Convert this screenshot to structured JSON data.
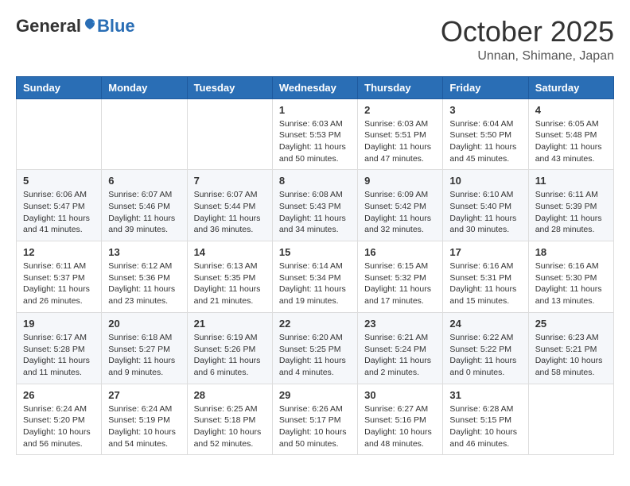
{
  "header": {
    "logo": {
      "general": "General",
      "blue": "Blue"
    },
    "title": "October 2025",
    "location": "Unnan, Shimane, Japan"
  },
  "weekdays": [
    "Sunday",
    "Monday",
    "Tuesday",
    "Wednesday",
    "Thursday",
    "Friday",
    "Saturday"
  ],
  "weeks": [
    [
      {
        "day": "",
        "content": ""
      },
      {
        "day": "",
        "content": ""
      },
      {
        "day": "",
        "content": ""
      },
      {
        "day": "1",
        "content": "Sunrise: 6:03 AM\nSunset: 5:53 PM\nDaylight: 11 hours\nand 50 minutes."
      },
      {
        "day": "2",
        "content": "Sunrise: 6:03 AM\nSunset: 5:51 PM\nDaylight: 11 hours\nand 47 minutes."
      },
      {
        "day": "3",
        "content": "Sunrise: 6:04 AM\nSunset: 5:50 PM\nDaylight: 11 hours\nand 45 minutes."
      },
      {
        "day": "4",
        "content": "Sunrise: 6:05 AM\nSunset: 5:48 PM\nDaylight: 11 hours\nand 43 minutes."
      }
    ],
    [
      {
        "day": "5",
        "content": "Sunrise: 6:06 AM\nSunset: 5:47 PM\nDaylight: 11 hours\nand 41 minutes."
      },
      {
        "day": "6",
        "content": "Sunrise: 6:07 AM\nSunset: 5:46 PM\nDaylight: 11 hours\nand 39 minutes."
      },
      {
        "day": "7",
        "content": "Sunrise: 6:07 AM\nSunset: 5:44 PM\nDaylight: 11 hours\nand 36 minutes."
      },
      {
        "day": "8",
        "content": "Sunrise: 6:08 AM\nSunset: 5:43 PM\nDaylight: 11 hours\nand 34 minutes."
      },
      {
        "day": "9",
        "content": "Sunrise: 6:09 AM\nSunset: 5:42 PM\nDaylight: 11 hours\nand 32 minutes."
      },
      {
        "day": "10",
        "content": "Sunrise: 6:10 AM\nSunset: 5:40 PM\nDaylight: 11 hours\nand 30 minutes."
      },
      {
        "day": "11",
        "content": "Sunrise: 6:11 AM\nSunset: 5:39 PM\nDaylight: 11 hours\nand 28 minutes."
      }
    ],
    [
      {
        "day": "12",
        "content": "Sunrise: 6:11 AM\nSunset: 5:37 PM\nDaylight: 11 hours\nand 26 minutes."
      },
      {
        "day": "13",
        "content": "Sunrise: 6:12 AM\nSunset: 5:36 PM\nDaylight: 11 hours\nand 23 minutes."
      },
      {
        "day": "14",
        "content": "Sunrise: 6:13 AM\nSunset: 5:35 PM\nDaylight: 11 hours\nand 21 minutes."
      },
      {
        "day": "15",
        "content": "Sunrise: 6:14 AM\nSunset: 5:34 PM\nDaylight: 11 hours\nand 19 minutes."
      },
      {
        "day": "16",
        "content": "Sunrise: 6:15 AM\nSunset: 5:32 PM\nDaylight: 11 hours\nand 17 minutes."
      },
      {
        "day": "17",
        "content": "Sunrise: 6:16 AM\nSunset: 5:31 PM\nDaylight: 11 hours\nand 15 minutes."
      },
      {
        "day": "18",
        "content": "Sunrise: 6:16 AM\nSunset: 5:30 PM\nDaylight: 11 hours\nand 13 minutes."
      }
    ],
    [
      {
        "day": "19",
        "content": "Sunrise: 6:17 AM\nSunset: 5:28 PM\nDaylight: 11 hours\nand 11 minutes."
      },
      {
        "day": "20",
        "content": "Sunrise: 6:18 AM\nSunset: 5:27 PM\nDaylight: 11 hours\nand 9 minutes."
      },
      {
        "day": "21",
        "content": "Sunrise: 6:19 AM\nSunset: 5:26 PM\nDaylight: 11 hours\nand 6 minutes."
      },
      {
        "day": "22",
        "content": "Sunrise: 6:20 AM\nSunset: 5:25 PM\nDaylight: 11 hours\nand 4 minutes."
      },
      {
        "day": "23",
        "content": "Sunrise: 6:21 AM\nSunset: 5:24 PM\nDaylight: 11 hours\nand 2 minutes."
      },
      {
        "day": "24",
        "content": "Sunrise: 6:22 AM\nSunset: 5:22 PM\nDaylight: 11 hours\nand 0 minutes."
      },
      {
        "day": "25",
        "content": "Sunrise: 6:23 AM\nSunset: 5:21 PM\nDaylight: 10 hours\nand 58 minutes."
      }
    ],
    [
      {
        "day": "26",
        "content": "Sunrise: 6:24 AM\nSunset: 5:20 PM\nDaylight: 10 hours\nand 56 minutes."
      },
      {
        "day": "27",
        "content": "Sunrise: 6:24 AM\nSunset: 5:19 PM\nDaylight: 10 hours\nand 54 minutes."
      },
      {
        "day": "28",
        "content": "Sunrise: 6:25 AM\nSunset: 5:18 PM\nDaylight: 10 hours\nand 52 minutes."
      },
      {
        "day": "29",
        "content": "Sunrise: 6:26 AM\nSunset: 5:17 PM\nDaylight: 10 hours\nand 50 minutes."
      },
      {
        "day": "30",
        "content": "Sunrise: 6:27 AM\nSunset: 5:16 PM\nDaylight: 10 hours\nand 48 minutes."
      },
      {
        "day": "31",
        "content": "Sunrise: 6:28 AM\nSunset: 5:15 PM\nDaylight: 10 hours\nand 46 minutes."
      },
      {
        "day": "",
        "content": ""
      }
    ]
  ]
}
